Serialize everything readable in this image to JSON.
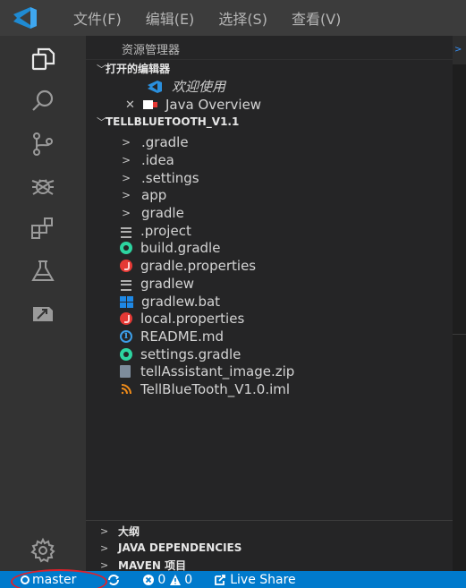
{
  "colors": {
    "accent": "#007acc",
    "titlebar": "#3c3c3c",
    "activitybar": "#333333",
    "sidebar": "#252526",
    "vscode_blue": "#3794ff",
    "gradle_green": "#2dd4a0",
    "java_red": "#e53935"
  },
  "menu": [
    "文件(F)",
    "编辑(E)",
    "选择(S)",
    "查看(V)"
  ],
  "activity_icons": [
    "explorer-icon",
    "search-icon",
    "source-control-icon",
    "debug-icon",
    "extensions-icon",
    "test-flask-icon",
    "remote-explorer-icon"
  ],
  "sidebar": {
    "title": "资源管理器",
    "open_editors": {
      "label": "打开的编辑器",
      "items": [
        {
          "label": "欢迎使用",
          "icon": "vscode-icon"
        },
        {
          "label": "Java Overview",
          "icon": "java-overview-icon"
        }
      ]
    },
    "project": {
      "label": "TELLBLUETOOTH_V1.1",
      "folders": [
        ".gradle",
        ".idea",
        ".settings",
        "app",
        "gradle"
      ],
      "files": [
        {
          "name": ".project",
          "icon": "lines-icon"
        },
        {
          "name": "build.gradle",
          "icon": "gradle-icon"
        },
        {
          "name": "gradle.properties",
          "icon": "java-icon"
        },
        {
          "name": "gradlew",
          "icon": "lines-icon"
        },
        {
          "name": "gradlew.bat",
          "icon": "windows-icon"
        },
        {
          "name": "local.properties",
          "icon": "java-icon"
        },
        {
          "name": "README.md",
          "icon": "info-icon"
        },
        {
          "name": "settings.gradle",
          "icon": "gradle-icon"
        },
        {
          "name": "tellAssistant_image.zip",
          "icon": "zip-icon"
        },
        {
          "name": "TellBlueTooth_V1.0.iml",
          "icon": "rss-icon"
        }
      ]
    },
    "bottom_sections": [
      "大纲",
      "JAVA DEPENDENCIES",
      "MAVEN 项目"
    ]
  },
  "statusbar": {
    "branch": "master",
    "errors": "0",
    "warnings": "0",
    "live_share": "Live Share"
  }
}
